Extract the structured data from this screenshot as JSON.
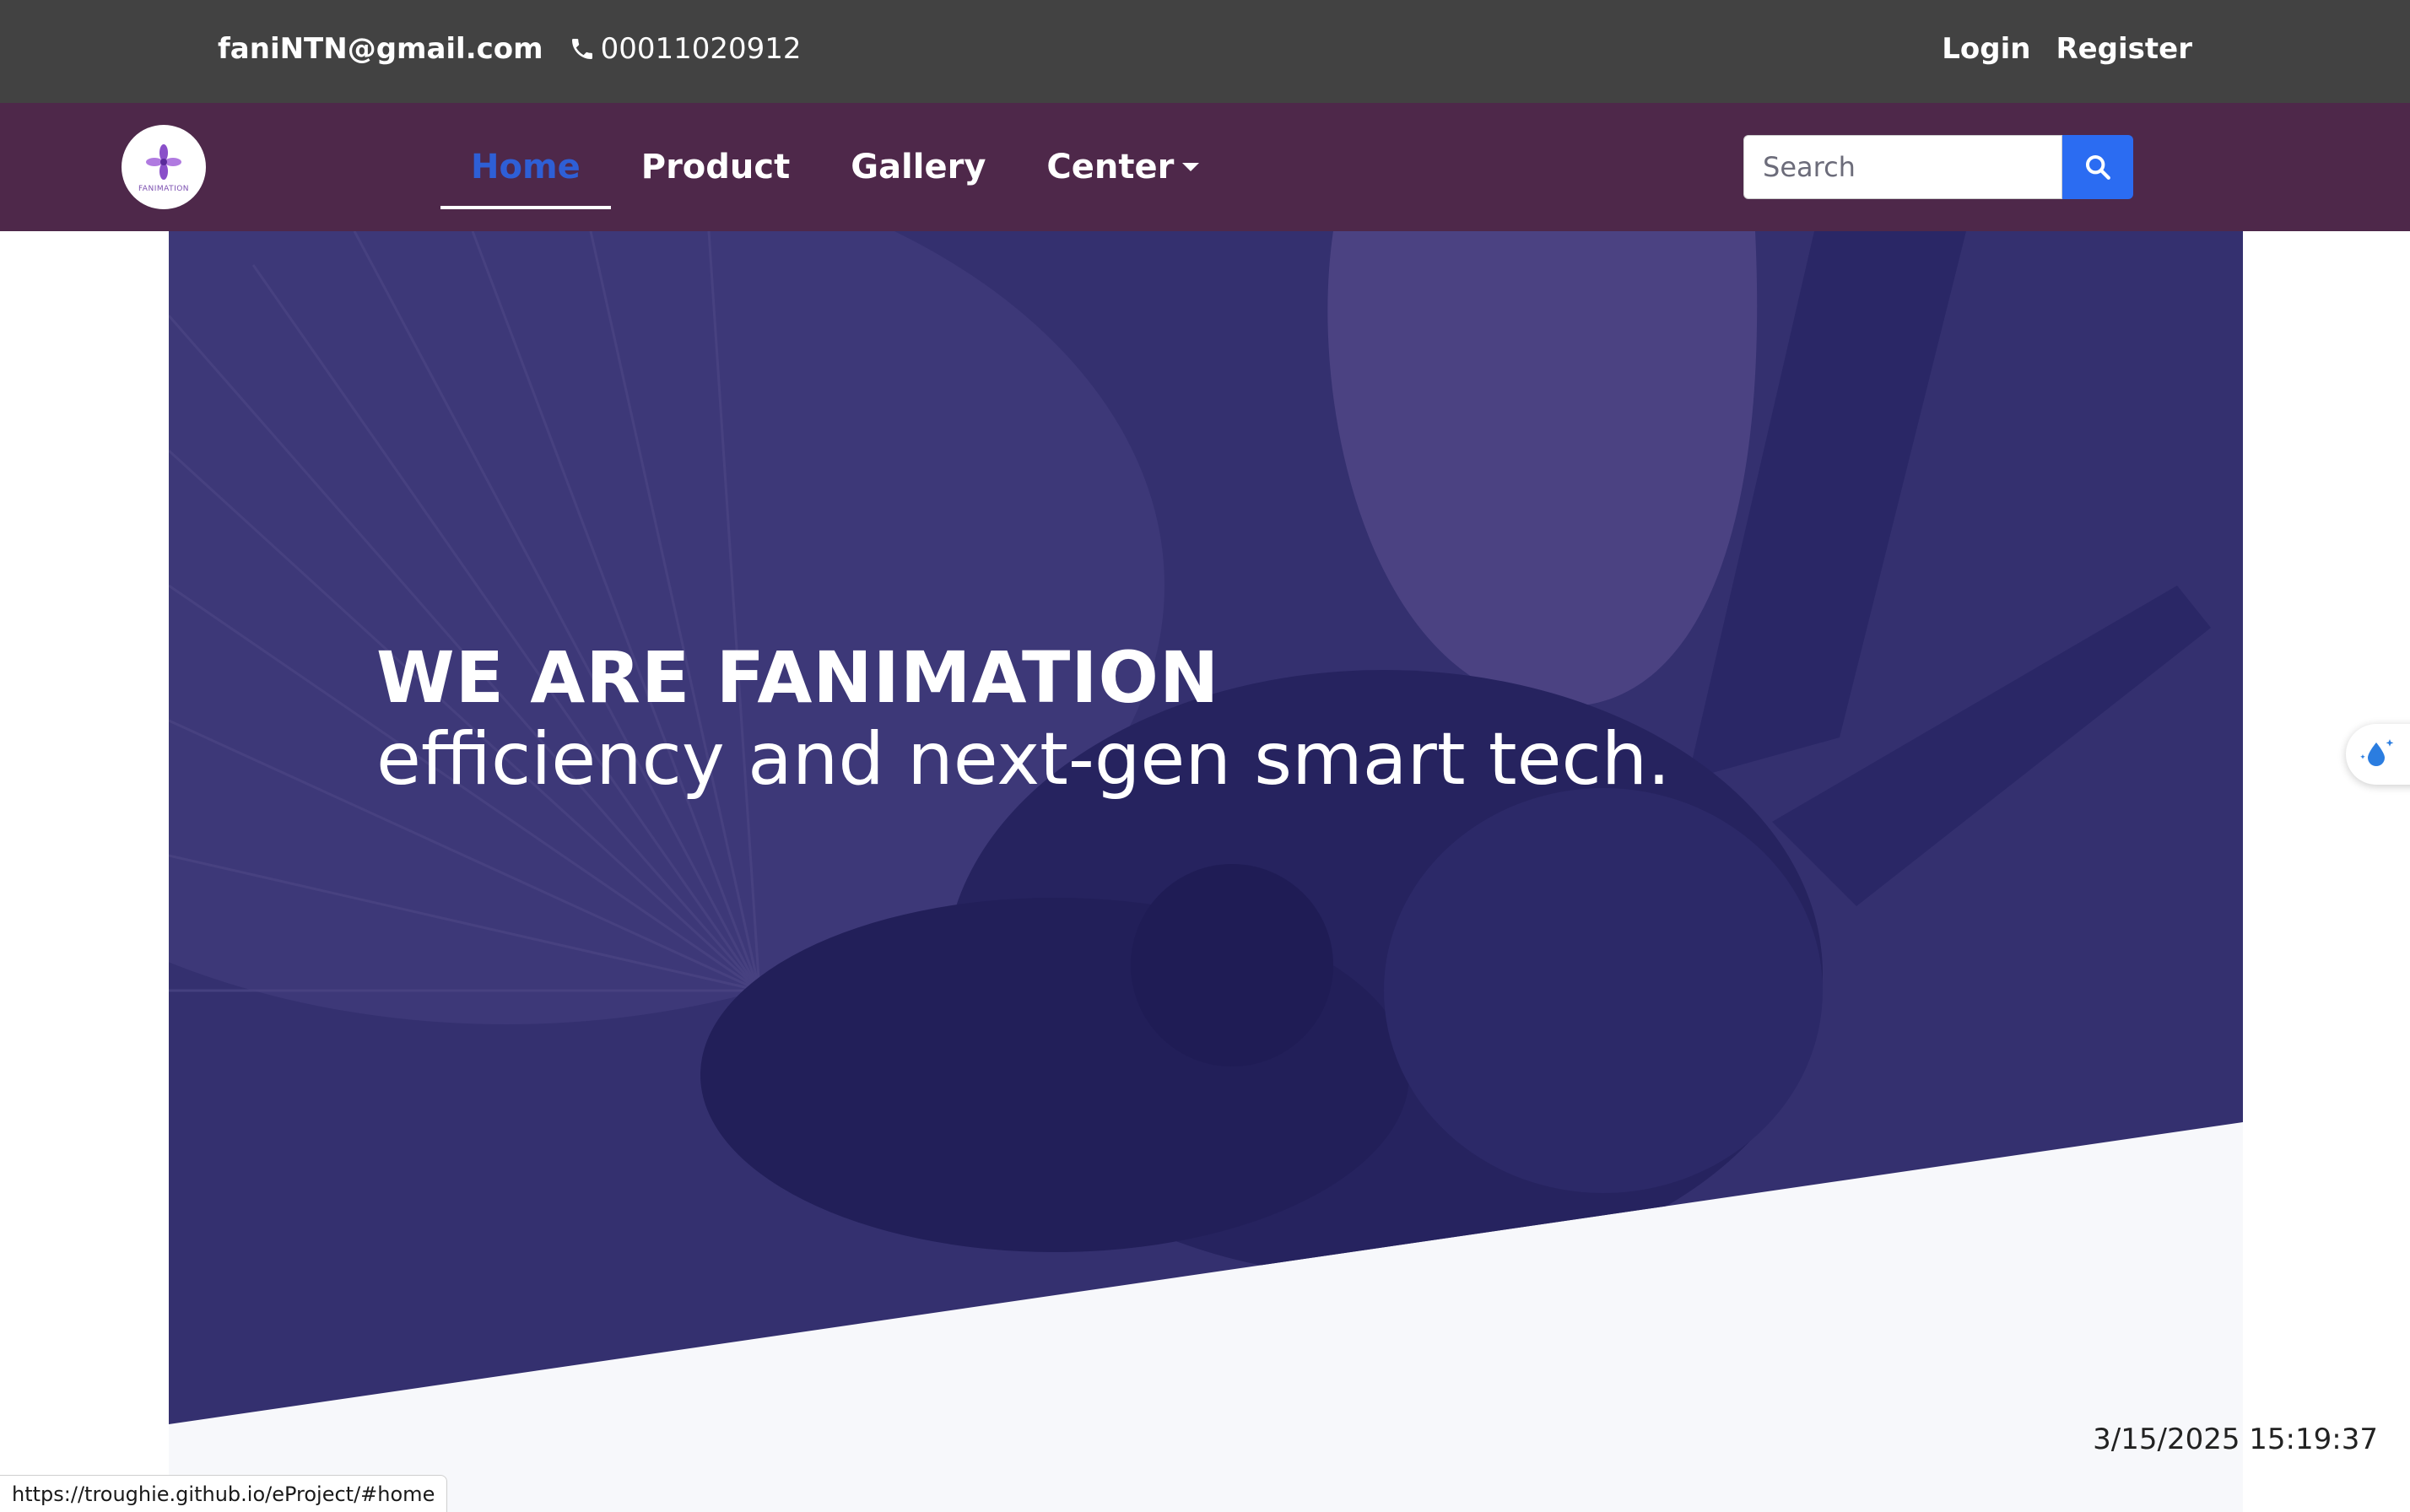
{
  "topbar": {
    "email": "faniNTN@gmail.com",
    "phone": "00011020912",
    "login": "Login",
    "register": "Register"
  },
  "logo": {
    "text": "FANIMATION"
  },
  "nav": {
    "items": [
      {
        "label": "Home",
        "active": true
      },
      {
        "label": "Product",
        "active": false
      },
      {
        "label": "Gallery",
        "active": false
      },
      {
        "label": "Center",
        "active": false,
        "dropdown": true
      }
    ]
  },
  "search": {
    "placeholder": "Search",
    "value": ""
  },
  "hero": {
    "title": "WE ARE FANIMATION",
    "subtitle": "efficiency and next-gen smart tech."
  },
  "timestamp": "3/15/2025 15:19:37",
  "status_url": "https://troughie.github.io/eProject/#home",
  "colors": {
    "topbar": "#424242",
    "navbar": "#4e284a",
    "accent": "#2b6cf2",
    "hero_overlay": "#2d2a6e"
  }
}
